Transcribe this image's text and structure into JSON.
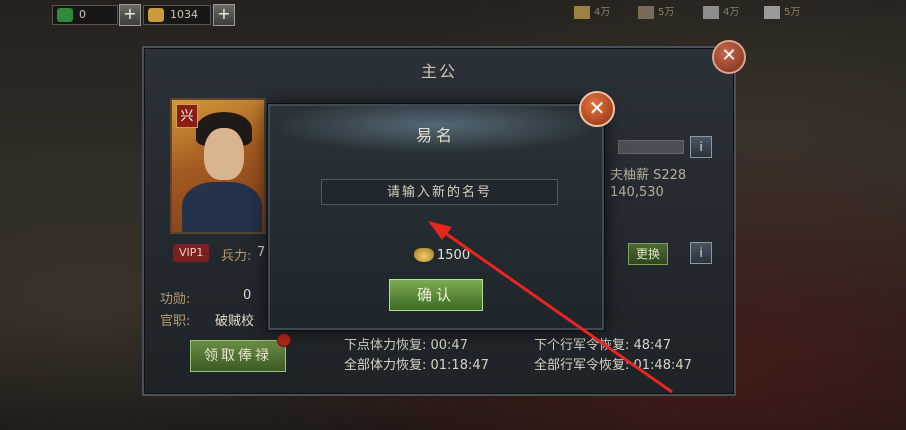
{
  "resources": {
    "jade": "0",
    "gold": "1034"
  },
  "troops": [
    {
      "icon": "grain-icon",
      "value": "4万"
    },
    {
      "icon": "cart-icon",
      "value": "5万"
    },
    {
      "icon": "horse-icon",
      "value": "4万"
    },
    {
      "icon": "spear-icon",
      "value": "5万"
    }
  ],
  "main_panel": {
    "title": "主公",
    "portrait_tag": "兴",
    "vip": "VIP1",
    "troops_label": "兵力:",
    "troops_value": "7",
    "merit_label": "功勋:",
    "merit_value": "0",
    "office_label": "官职:",
    "office_value": "破贼校",
    "collect_button": "领取俸禄",
    "right_name": "夫柚薪 S228",
    "right_coords": "140,530",
    "replace_button": "更换",
    "info_button": "i",
    "recovery": {
      "next_stamina": "下点体力恢复: 00:47",
      "all_stamina": "全部体力恢复: 01:18:47",
      "next_order": "下个行军令恢复: 48:47",
      "all_order": "全部行军令恢复: 01:48:47"
    }
  },
  "dialog": {
    "title": "易名",
    "input_placeholder": "请输入新的名号",
    "cost": "1500",
    "confirm_button": "确认"
  },
  "colors": {
    "annotation_arrow": "#e8261f",
    "confirm_green": "#5f8f3a",
    "close_orange": "#c8562a"
  }
}
